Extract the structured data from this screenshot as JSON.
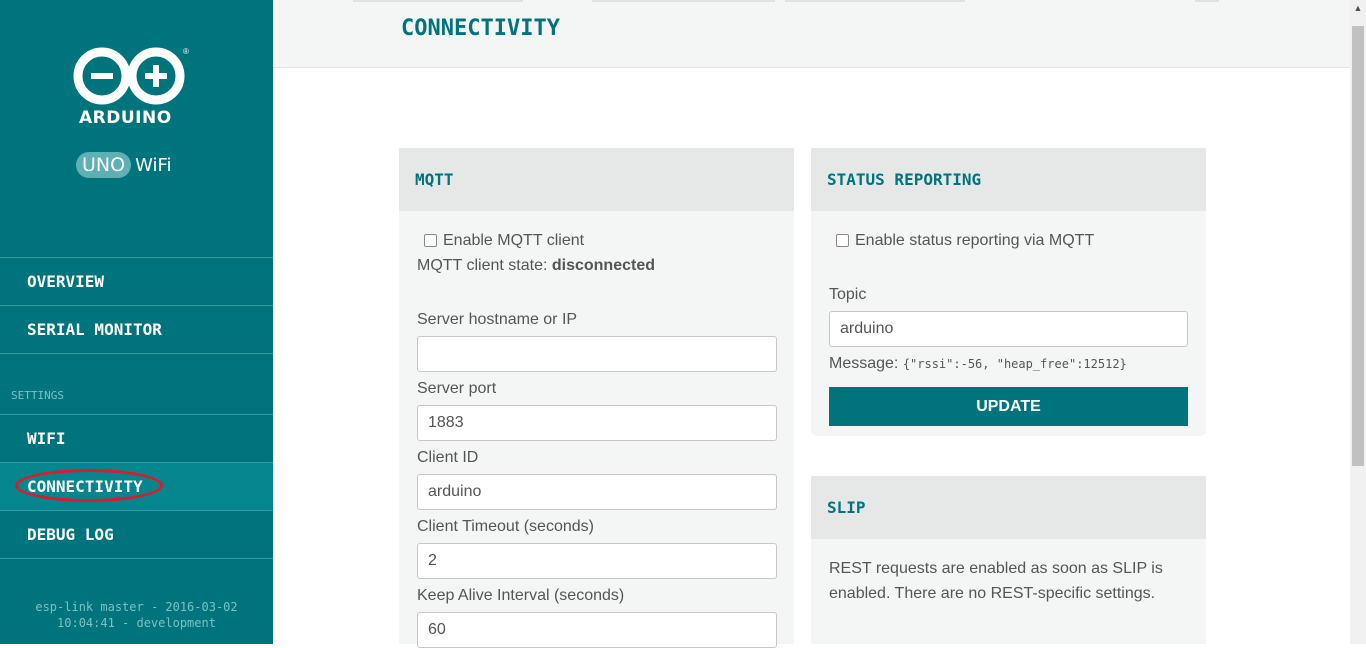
{
  "sidebar": {
    "brand": "ARDUINO",
    "registered": "®",
    "uno": "UNO",
    "wifi": "WiFi",
    "nav": {
      "overview": "OVERVIEW",
      "serial_monitor": "SERIAL MONITOR",
      "settings_label": "SETTINGS",
      "wifi": "WIFI",
      "connectivity": "CONNECTIVITY",
      "debug_log": "DEBUG LOG"
    },
    "footer_line1": "esp-link master - 2016-03-02",
    "footer_line2": "10:04:41 - development"
  },
  "header": {
    "title": "CONNECTIVITY"
  },
  "mqtt": {
    "title": "MQTT",
    "enable_label": "Enable MQTT client",
    "enable_checked": false,
    "state_label": "MQTT client state: ",
    "state_value": "disconnected",
    "server_label": "Server hostname or IP",
    "server_value": "",
    "port_label": "Server port",
    "port_value": "1883",
    "client_id_label": "Client ID",
    "client_id_value": "arduino",
    "timeout_label": "Client Timeout (seconds)",
    "timeout_value": "2",
    "keepalive_label": "Keep Alive Interval (seconds)",
    "keepalive_value": "60"
  },
  "status": {
    "title": "STATUS REPORTING",
    "enable_label": "Enable status reporting via MQTT",
    "enable_checked": false,
    "topic_label": "Topic",
    "topic_value": "arduino",
    "message_label": "Message: ",
    "message_value": "{\"rssi\":-56, \"heap_free\":12512}",
    "update_button": "UPDATE"
  },
  "slip": {
    "title": "SLIP",
    "text_line1": "REST requests are enabled as soon as SLIP is",
    "text_line2": "enabled. There are no REST-specific settings."
  },
  "colors": {
    "accent": "#00747c",
    "highlight": "#e0192a"
  }
}
